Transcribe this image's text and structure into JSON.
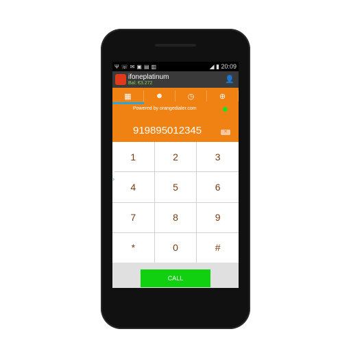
{
  "status": {
    "icons": [
      "usb-icon",
      "missed-call-icon",
      "mail-icon",
      "n-icon",
      "doc-icon",
      "bag-icon"
    ],
    "time": "20:09"
  },
  "app": {
    "title": "ifoneplatinum",
    "balance": "Bal: €3.272"
  },
  "tabs": [
    {
      "name": "keypad",
      "icon": "▦"
    },
    {
      "name": "contacts",
      "icon": "☻"
    },
    {
      "name": "history",
      "icon": "◷"
    },
    {
      "name": "upload",
      "icon": "⊕"
    }
  ],
  "powered": "Powered by orangedialer.com",
  "number": "919895012345",
  "keys": [
    "1",
    "2",
    "3",
    "4",
    "5",
    "6",
    "7",
    "8",
    "9",
    "*",
    "0",
    "#"
  ],
  "call": "CALL",
  "colors": {
    "accent": "#f08214",
    "call": "#10d010",
    "online": "#1ee01e"
  }
}
